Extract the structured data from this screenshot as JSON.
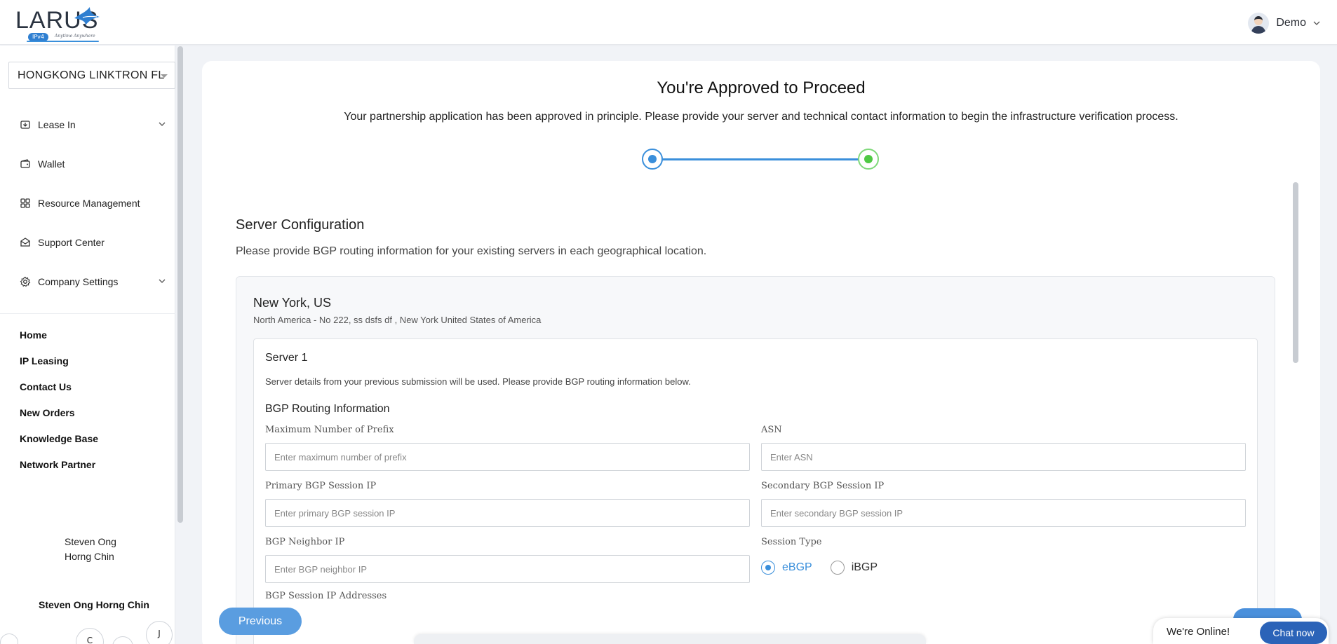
{
  "header": {
    "logo_text": "LARUS",
    "logo_badge": "IPv4",
    "logo_tagline": "Anytime Anywhere",
    "user_name": "Demo"
  },
  "sidebar": {
    "company": "HONGKONG LINKTRON FL",
    "nav": [
      {
        "label": "Lease In",
        "icon": "download-box-icon",
        "expandable": true
      },
      {
        "label": "Wallet",
        "icon": "wallet-icon",
        "expandable": false
      },
      {
        "label": "Resource Management",
        "icon": "grid-icon",
        "expandable": false
      },
      {
        "label": "Support Center",
        "icon": "envelope-icon",
        "expandable": false
      },
      {
        "label": "Company Settings",
        "icon": "gear-icon",
        "expandable": true
      }
    ],
    "links": [
      "Home",
      "IP Leasing",
      "Contact Us",
      "New Orders",
      "Knowledge Base",
      "Network Partner"
    ],
    "person_line1": "Steven Ong",
    "person_line2": "Horng Chin",
    "person_full": "Steven Ong Horng Chin",
    "bubbles": [
      "C",
      "J"
    ]
  },
  "main": {
    "title": "You're Approved to Proceed",
    "subtitle": "Your partnership application has been approved in principle. Please provide your server and technical contact information to begin the infrastructure verification process.",
    "section_title": "Server Configuration",
    "section_desc": "Please provide BGP routing information for your existing servers in each geographical location.",
    "location": {
      "title": "New York, US",
      "address": "North America - No 222, ss dsfs df , New York United States of America"
    },
    "server": {
      "title": "Server 1",
      "desc": "Server details from your previous submission will be used. Please provide BGP routing information below.",
      "bgp_title": "BGP Routing Information",
      "fields": {
        "max_prefix": {
          "label": "Maximum Number of Prefix",
          "placeholder": "Enter maximum number of prefix"
        },
        "asn": {
          "label": "ASN",
          "placeholder": "Enter ASN"
        },
        "primary_ip": {
          "label": "Primary BGP Session IP",
          "placeholder": "Enter primary BGP session IP"
        },
        "secondary_ip": {
          "label": "Secondary BGP Session IP",
          "placeholder": "Enter secondary BGP session IP"
        },
        "neighbor_ip": {
          "label": "BGP Neighbor IP",
          "placeholder": "Enter BGP neighbor IP"
        }
      },
      "session_type_label": "Session Type",
      "session_types": [
        {
          "label": "eBGP",
          "selected": true
        },
        {
          "label": "iBGP",
          "selected": false
        }
      ],
      "session_addresses_label": "BGP Session IP Addresses"
    },
    "previous_label": "Previous"
  },
  "chat": {
    "status": "We're Online!",
    "button": "Chat now"
  },
  "colors": {
    "accent": "#3a8fdb",
    "step_complete": "#4fc944",
    "chat_button": "#2b63b8"
  }
}
